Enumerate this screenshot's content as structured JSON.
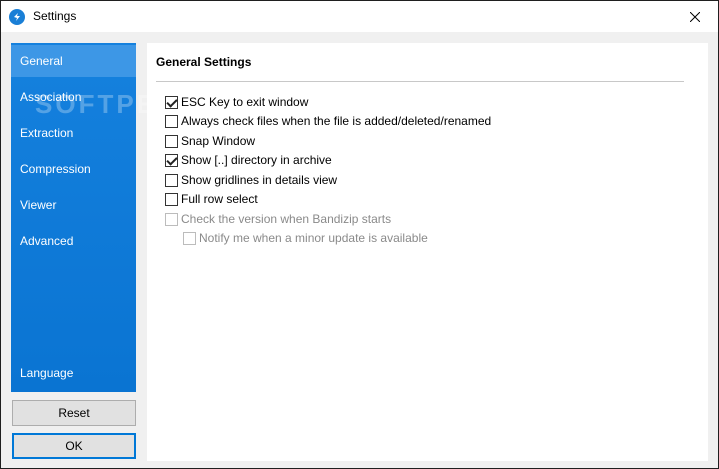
{
  "window": {
    "title": "Settings"
  },
  "colors": {
    "sidebar": "#0f7ad8",
    "sidebar_active": "#3d97e6",
    "accent": "#0078d7"
  },
  "sidebar": {
    "items": [
      {
        "label": "General",
        "active": true
      },
      {
        "label": "Association"
      },
      {
        "label": "Extraction"
      },
      {
        "label": "Compression"
      },
      {
        "label": "Viewer"
      },
      {
        "label": "Advanced"
      }
    ],
    "language_label": "Language"
  },
  "buttons": {
    "reset_label": "Reset",
    "ok_label": "OK"
  },
  "main": {
    "title": "General Settings",
    "options": [
      {
        "label": "ESC Key to exit window",
        "checked": true
      },
      {
        "label": "Always check files when the file is added/deleted/renamed",
        "checked": false
      },
      {
        "label": "Snap Window",
        "checked": false
      },
      {
        "label": "Show [..] directory in archive",
        "checked": true
      },
      {
        "label": "Show gridlines in details view",
        "checked": false
      },
      {
        "label": "Full row select",
        "checked": false
      },
      {
        "label": "Check the version when Bandizip starts",
        "checked": false,
        "disabled": true
      },
      {
        "label": "Notify me when a minor update is available",
        "checked": false,
        "disabled": true
      }
    ]
  },
  "watermark": "SOFTPEDIA"
}
